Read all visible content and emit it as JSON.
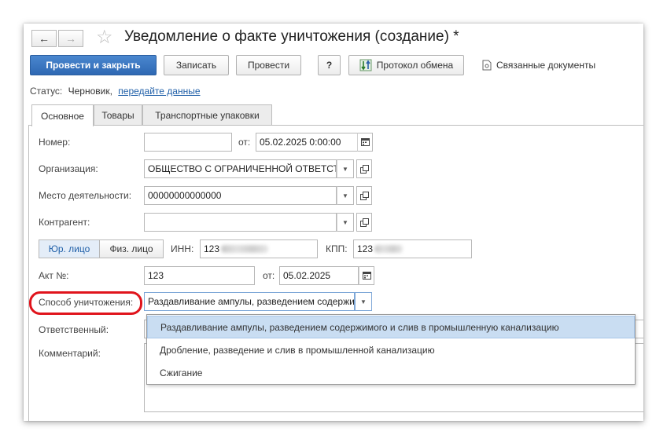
{
  "window": {
    "title": "Уведомление о факте уничтожения (создание) *"
  },
  "nav": {
    "back_icon": "←",
    "forward_icon": "→",
    "star_icon": "☆"
  },
  "toolbar": {
    "post_close": "Провести и закрыть",
    "save": "Записать",
    "post": "Провести",
    "help": "?",
    "exchange_log": "Протокол обмена",
    "related_docs": "Связанные документы"
  },
  "status": {
    "label": "Статус:",
    "value": "Черновик,",
    "link": "передайте данные"
  },
  "tabs": [
    "Основное",
    "Товары",
    "Транспортные упаковки"
  ],
  "form": {
    "number_label": "Номер:",
    "number_value": "",
    "from_label": "от:",
    "date_value": "05.02.2025  0:00:00",
    "org_label": "Организация:",
    "org_value": "ОБЩЕСТВО С ОГРАНИЧЕННОЙ ОТВЕТСТВЕННОСТЬЮ",
    "place_label": "Место деятельности:",
    "place_value": "00000000000000",
    "counterparty_label": "Контрагент:",
    "counterparty_value": "",
    "legal_entity": "Юр. лицо",
    "individual": "Физ. лицо",
    "inn_label": "ИНН:",
    "inn_value": "123",
    "kpp_label": "КПП:",
    "kpp_value": "123",
    "act_label": "Акт №:",
    "act_value": "123",
    "act_from_label": "от:",
    "act_date": "05.02.2025",
    "method_label": "Способ уничтожения:",
    "method_value": "Раздавливание ампулы, разведением содержимого и слив в промышленную канализацию",
    "responsible_label": "Ответственный:",
    "comment_label": "Комментарий:"
  },
  "dropdown": {
    "options": [
      "Раздавливание ампулы, разведением содержимого и слив в промышленную канализацию",
      "Дробление, разведение и слив в промышленной канализацию",
      "Сжигание"
    ],
    "selected_index": 0
  },
  "colors": {
    "primary": "#3a78c2",
    "link": "#1f5fa8",
    "highlight_ring": "#e0141c",
    "selected_option": "#c9ddf2"
  }
}
